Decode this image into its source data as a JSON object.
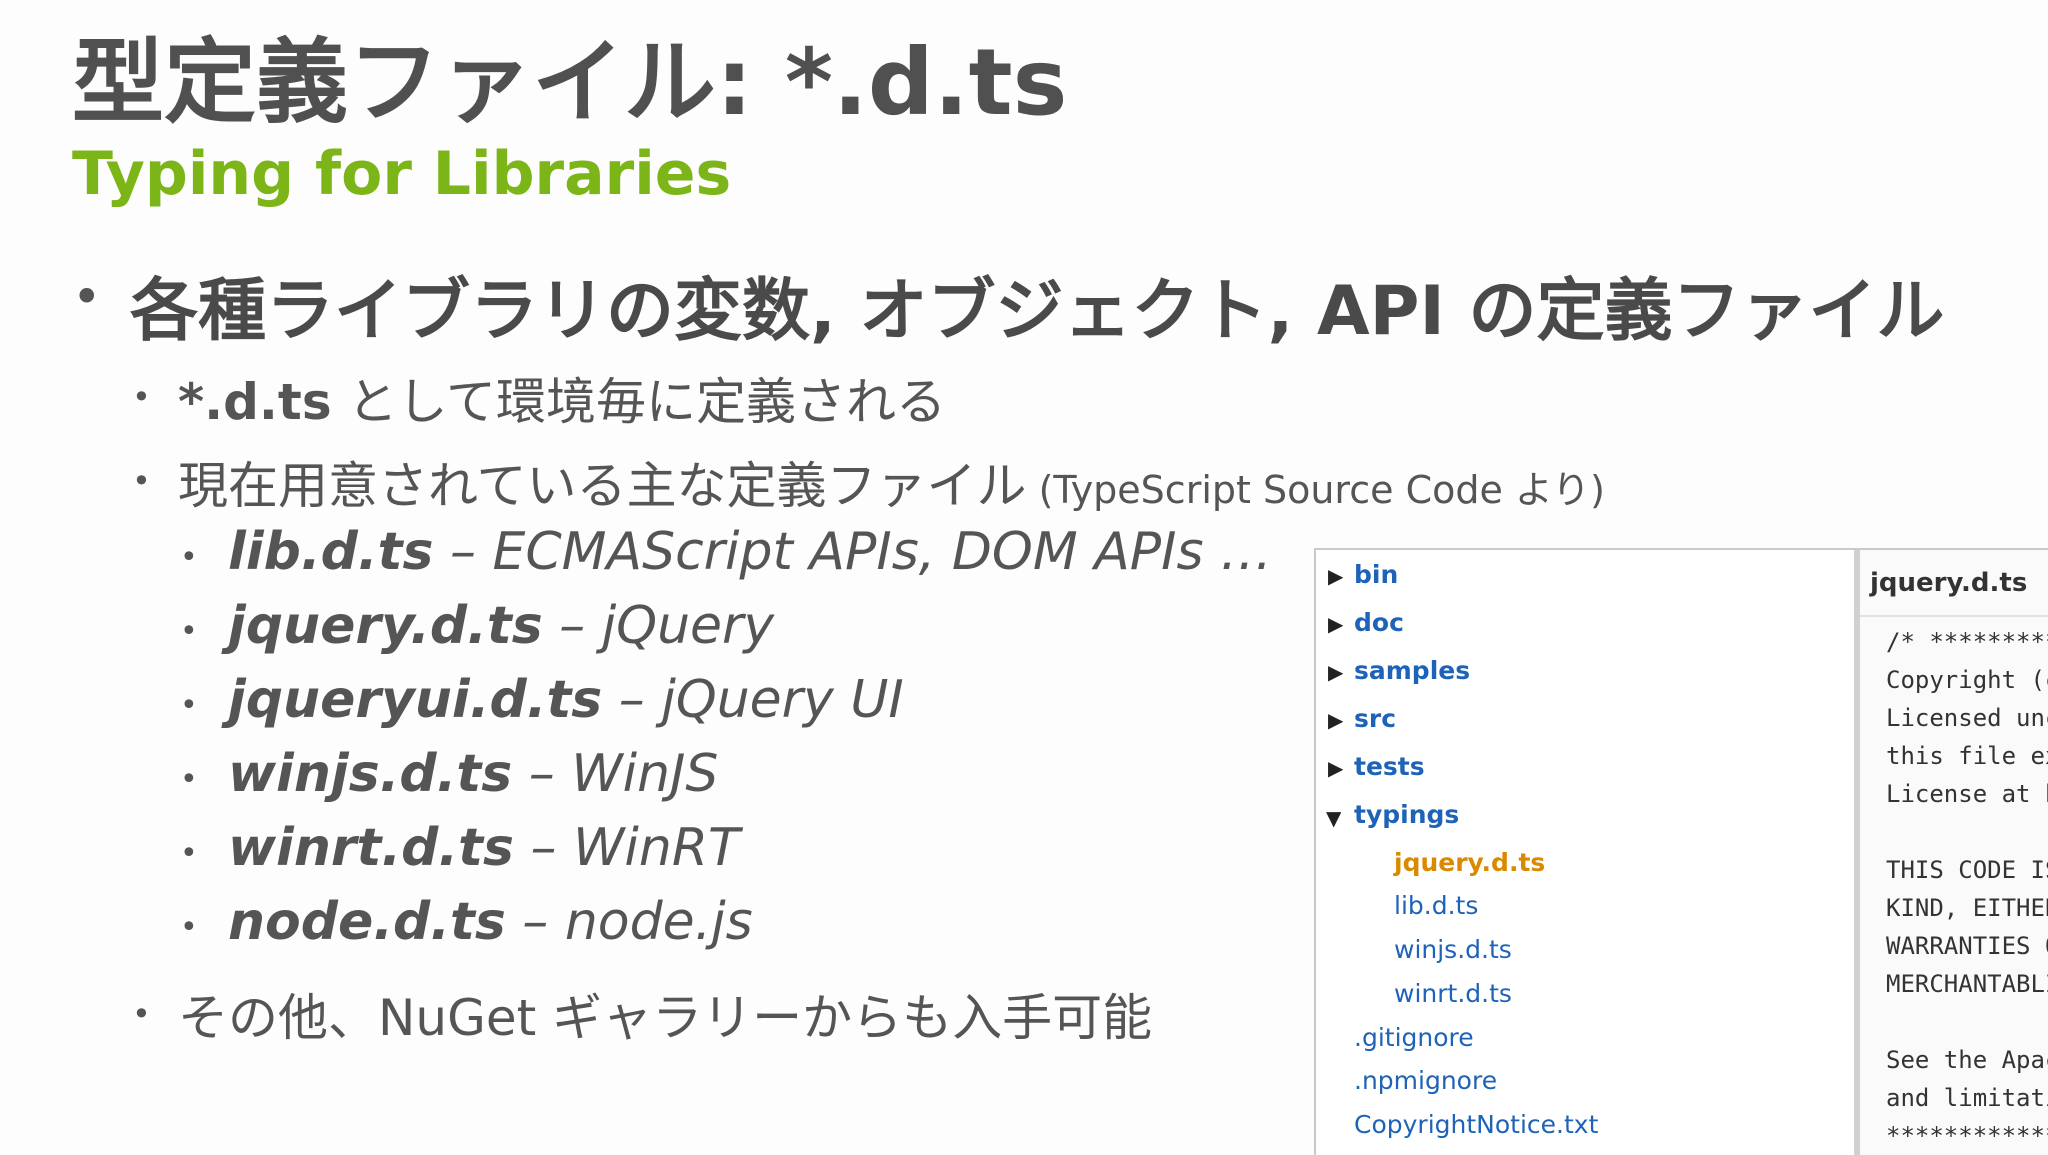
{
  "title": "型定義ファイル: *.d.ts",
  "subtitle": "Typing for Libraries",
  "bullet_glyph": "•",
  "main_point": "各種ライブラリの変数, オブジェクト, API の定義ファイル",
  "sub_points": {
    "env_bold": "*.d.ts",
    "env_rest": " として環境毎に定義される",
    "current_main": "現在用意されている主な定義ファイル",
    "current_note": " (TypeScript Source Code より)",
    "other": "その他、NuGet ギャラリーからも入手可能"
  },
  "definitions": [
    {
      "file": "lib.d.ts",
      "desc": " – ECMAScript APIs, DOM APIs …"
    },
    {
      "file": "jquery.d.ts",
      "desc": " – jQuery"
    },
    {
      "file": "jqueryui.d.ts",
      "desc": " – jQuery UI"
    },
    {
      "file": "winjs.d.ts",
      "desc": " – WinJS"
    },
    {
      "file": "winrt.d.ts",
      "desc": " – WinRT"
    },
    {
      "file": "node.d.ts",
      "desc": " – node.js"
    }
  ],
  "explorer": {
    "folders": [
      "bin",
      "doc",
      "samples",
      "src",
      "tests",
      "typings"
    ],
    "typings_files": [
      "jquery.d.ts",
      "lib.d.ts",
      "winjs.d.ts",
      "winrt.d.ts"
    ],
    "root_files": [
      ".gitignore",
      ".npmignore",
      "CopyrightNotice.txt"
    ],
    "collapsed_arrow": "▶",
    "expanded_arrow": "▼"
  },
  "editor": {
    "tab": "jquery.d.ts",
    "lines": [
      "/* *********",
      "Copyright (c",
      "Licensed unc",
      "this file ex",
      "License at h",
      "THIS CODE IS",
      "KIND, EITHER",
      "WARRANTIES O",
      "MERCHANTABLI",
      "See the Apac",
      "and limitati",
      "************"
    ]
  },
  "colors": {
    "title": "#505050",
    "subtitle": "#7cb518",
    "link": "#1e63b8",
    "active_file": "#d98a00"
  }
}
